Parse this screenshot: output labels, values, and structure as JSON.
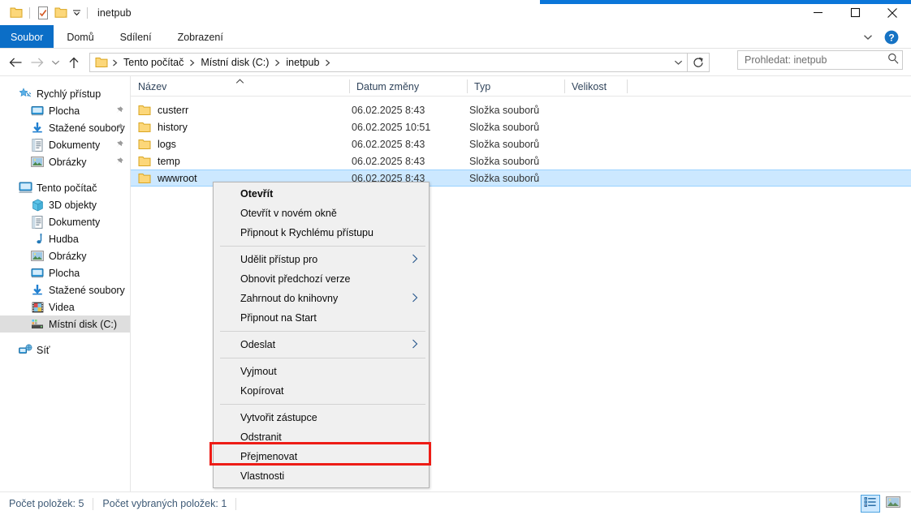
{
  "window": {
    "title": "inetpub",
    "accent_color": "#0b76d9",
    "quick_access_icons": [
      "folder-icon",
      "properties-icon",
      "folder-icon",
      "chevron-down-icon"
    ],
    "caption_buttons": [
      {
        "name": "minimize-button",
        "glyph": "minimize"
      },
      {
        "name": "maximize-button",
        "glyph": "maximize"
      },
      {
        "name": "close-button",
        "glyph": "close"
      }
    ]
  },
  "ribbon": {
    "tabs": [
      {
        "label": "Soubor",
        "selected": true
      },
      {
        "label": "Domů",
        "selected": false
      },
      {
        "label": "Sdílení",
        "selected": false
      },
      {
        "label": "Zobrazení",
        "selected": false
      }
    ],
    "expand_icon": "chevron-down-icon",
    "help_icon": "help-icon",
    "file_tab_color": "#0b6ec7"
  },
  "navigation": {
    "back_icon": "arrow-left-icon",
    "forward_icon": "arrow-right-icon",
    "recent_icon": "chevron-down-icon",
    "up_icon": "arrow-up-icon",
    "address": {
      "folder_icon": "folder-icon",
      "breadcrumbs": [
        "Tento počítač",
        "Místní disk (C:)",
        "inetpub"
      ],
      "dropdown_icon": "chevron-down-icon"
    },
    "refresh_icon": "refresh-icon",
    "search": {
      "placeholder": "Prohledat: inetpub",
      "value": "",
      "icon": "search-icon"
    }
  },
  "sidebar": {
    "groups": [
      {
        "header": {
          "label": "Rychlý přístup",
          "icon": "star-pin-icon"
        },
        "items": [
          {
            "label": "Plocha",
            "icon": "desktop-icon",
            "pinned": true
          },
          {
            "label": "Stažené soubory",
            "icon": "downloads-icon",
            "pinned": true
          },
          {
            "label": "Dokumenty",
            "icon": "documents-icon",
            "pinned": true
          },
          {
            "label": "Obrázky",
            "icon": "pictures-icon",
            "pinned": true
          }
        ]
      },
      {
        "header": {
          "label": "Tento počítač",
          "icon": "this-pc-icon"
        },
        "items": [
          {
            "label": "3D objekty",
            "icon": "3d-objects-icon",
            "pinned": false
          },
          {
            "label": "Dokumenty",
            "icon": "documents-icon",
            "pinned": false
          },
          {
            "label": "Hudba",
            "icon": "music-icon",
            "pinned": false
          },
          {
            "label": "Obrázky",
            "icon": "pictures-icon",
            "pinned": false
          },
          {
            "label": "Plocha",
            "icon": "desktop-icon",
            "pinned": false
          },
          {
            "label": "Stažené soubory",
            "icon": "downloads-icon",
            "pinned": false
          },
          {
            "label": "Videa",
            "icon": "videos-icon",
            "pinned": false
          },
          {
            "label": "Místní disk (C:)",
            "icon": "drive-icon",
            "pinned": false,
            "selected": true
          }
        ]
      },
      {
        "header": {
          "label": "Síť",
          "icon": "network-icon"
        },
        "items": []
      }
    ]
  },
  "file_list": {
    "columns": [
      {
        "label": "Název",
        "sorted": true,
        "sort_direction": "asc"
      },
      {
        "label": "Datum změny",
        "sorted": false
      },
      {
        "label": "Typ",
        "sorted": false
      },
      {
        "label": "Velikost",
        "sorted": false
      }
    ],
    "rows": [
      {
        "name": "custerr",
        "date": "06.02.2025 8:43",
        "type": "Složka souborů",
        "size": "",
        "icon": "folder-icon",
        "selected": false
      },
      {
        "name": "history",
        "date": "06.02.2025 10:51",
        "type": "Složka souborů",
        "size": "",
        "icon": "folder-icon",
        "selected": false
      },
      {
        "name": "logs",
        "date": "06.02.2025 8:43",
        "type": "Složka souborů",
        "size": "",
        "icon": "folder-icon",
        "selected": false
      },
      {
        "name": "temp",
        "date": "06.02.2025 8:43",
        "type": "Složka souborů",
        "size": "",
        "icon": "folder-icon",
        "selected": false
      },
      {
        "name": "wwwroot",
        "date": "06.02.2025 8:43",
        "type": "Složka souborů",
        "size": "",
        "icon": "folder-icon",
        "selected": true
      }
    ]
  },
  "context_menu": {
    "items": [
      {
        "label": "Otevřít",
        "bold": true,
        "submenu": false,
        "separator_after": false
      },
      {
        "label": "Otevřít v novém okně",
        "bold": false,
        "submenu": false,
        "separator_after": false
      },
      {
        "label": "Připnout k Rychlému přístupu",
        "bold": false,
        "submenu": false,
        "separator_after": true
      },
      {
        "label": "Udělit přístup pro",
        "bold": false,
        "submenu": true,
        "separator_after": false
      },
      {
        "label": "Obnovit předchozí verze",
        "bold": false,
        "submenu": false,
        "separator_after": false
      },
      {
        "label": "Zahrnout do knihovny",
        "bold": false,
        "submenu": true,
        "separator_after": false
      },
      {
        "label": "Připnout na Start",
        "bold": false,
        "submenu": false,
        "separator_after": true
      },
      {
        "label": "Odeslat",
        "bold": false,
        "submenu": true,
        "separator_after": true
      },
      {
        "label": "Vyjmout",
        "bold": false,
        "submenu": false,
        "separator_after": false
      },
      {
        "label": "Kopírovat",
        "bold": false,
        "submenu": false,
        "separator_after": true
      },
      {
        "label": "Vytvořit zástupce",
        "bold": false,
        "submenu": false,
        "separator_after": false
      },
      {
        "label": "Odstranit",
        "bold": false,
        "submenu": false,
        "separator_after": false
      },
      {
        "label": "Přejmenovat",
        "bold": false,
        "submenu": false,
        "separator_after": false
      },
      {
        "label": "Vlastnosti",
        "bold": false,
        "submenu": false,
        "separator_after": false,
        "highlighted": true
      }
    ],
    "highlight_color": "#ed1c16"
  },
  "status_bar": {
    "item_count": "Počet položek: 5",
    "selected_count": "Počet vybraných položek: 1",
    "view_buttons": [
      {
        "name": "details-view-button",
        "icon": "details-view-icon",
        "active": true
      },
      {
        "name": "large-icons-view-button",
        "icon": "large-icons-view-icon",
        "active": false
      }
    ]
  }
}
